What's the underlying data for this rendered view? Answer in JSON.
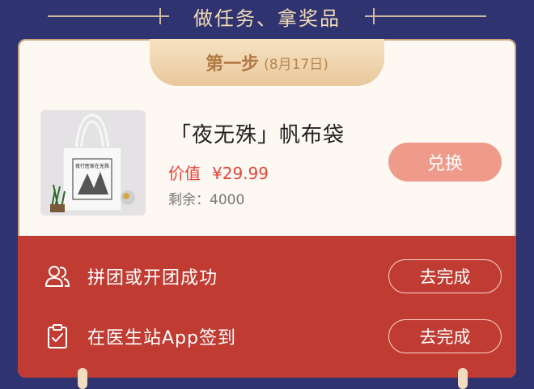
{
  "header": {
    "title": "做任务、拿奖品"
  },
  "step": {
    "label": "第一步",
    "date": "(8月17日)"
  },
  "product": {
    "image_text": "夜行医家在无殊",
    "name": "「夜无殊」帆布袋",
    "price_label": "价值",
    "price_value": "¥29.99",
    "remaining": "剩余：4000",
    "redeem_label": "兑换"
  },
  "tasks": [
    {
      "icon": "users-icon",
      "label": "拼团或开团成功",
      "button": "去完成"
    },
    {
      "icon": "clipboard-check-icon",
      "label": "在医生站App签到",
      "button": "去完成"
    }
  ],
  "colors": {
    "background": "#2f3370",
    "card": "#fdf8f2",
    "task_panel": "#c03c33",
    "price_red": "#e1453b",
    "redeem_button": "#ee9b8c",
    "gold": "#b07a44"
  }
}
